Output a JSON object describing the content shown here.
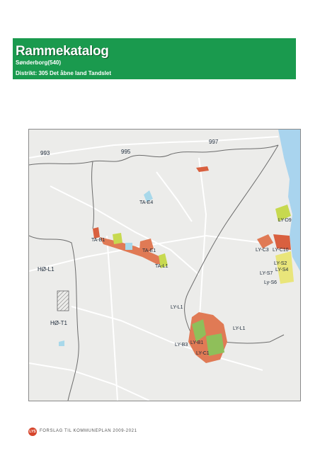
{
  "header": {
    "title": "Rammekatalog",
    "municipality": "Sønderborg(540)",
    "district": "Distrikt: 305 Det åbne land Tandslet"
  },
  "map": {
    "labels": {
      "d993": "993",
      "d995": "995",
      "d997": "997",
      "ta_e4": "TA-E4",
      "ta_b1": "TA-B1",
      "ta_e1": "TA-E1",
      "ta_l1": "TA-L1",
      "ho_l1": "HØ-L1",
      "ho_t1": "HØ-T1",
      "ly_l1_a": "LY-L1",
      "ly_l1_b": "LY-L1",
      "ly_d9": "LY-D9",
      "ly_c3": "LY-C3",
      "ly_c10": "LY-C10",
      "ly_s2": "LY-S2",
      "ly_s4": "LY-S4",
      "ly_s7": "LY-S7",
      "ly_s6": "Ly-S6",
      "ly_b3": "LY-B3",
      "ly_b1": "LY-B1",
      "ly_c1": "LY-C1"
    },
    "colors": {
      "residential": "#e07a55",
      "commercial": "#d9603f",
      "recreation": "#c7d94f",
      "green": "#8fbf5a",
      "summerhouse": "#e9e57a",
      "water": "#a8d8ea",
      "sea": "#a9d4ee",
      "road": "#ffffff",
      "boundary": "#6c6c6c"
    }
  },
  "footer": {
    "logo_text": "LYS",
    "text": "FORSLAG TIL KOMMUNEPLAN 2009-2021"
  }
}
